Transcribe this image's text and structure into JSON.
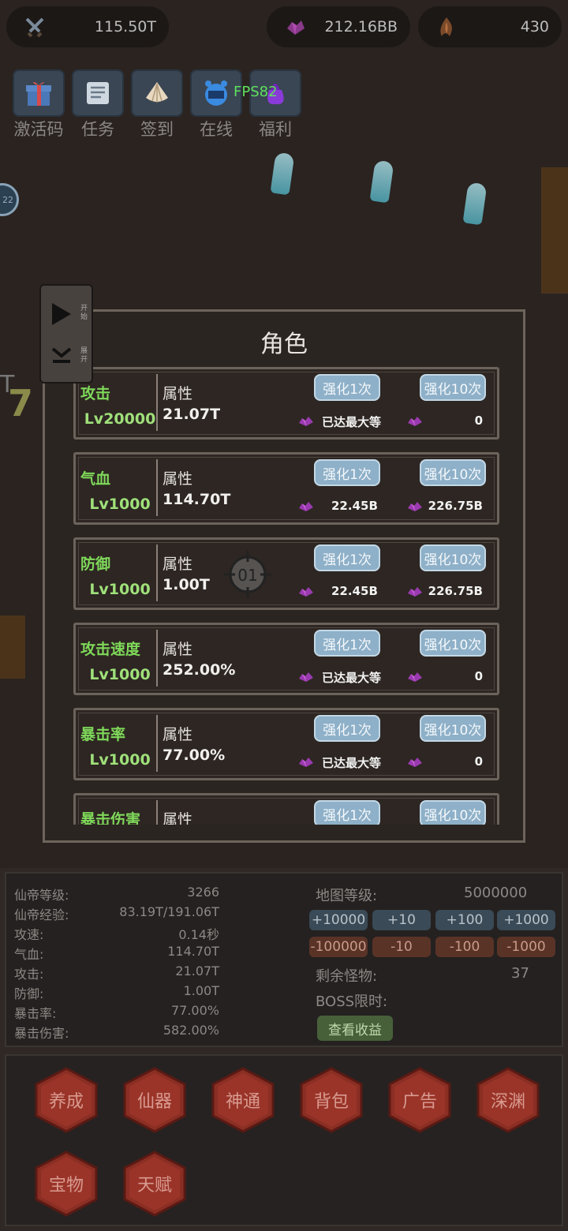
{
  "currency": {
    "attack_power": "115.50T",
    "gems": "212.16BB",
    "souls": "430"
  },
  "fps": "FPS82",
  "top_features": [
    {
      "label": "激活码",
      "icon": "gift-icon"
    },
    {
      "label": "任务",
      "icon": "task-board-icon"
    },
    {
      "label": "签到",
      "icon": "shell-icon"
    },
    {
      "label": "在线",
      "icon": "clock-icon"
    },
    {
      "label": "福利",
      "icon": "magic-bag-icon"
    }
  ],
  "side_circle_badge": "22",
  "side_panel": {
    "start_label": "开始",
    "expand_label": "展开"
  },
  "dialog": {
    "title": "角色",
    "attr_label": "属性",
    "upgrade1_label": "强化1次",
    "upgrade10_label": "强化10次",
    "rows": [
      {
        "name": "攻击",
        "level": "Lv20000",
        "value": "21.07T",
        "cost1": "已达最大等",
        "cost10": "0"
      },
      {
        "name": "气血",
        "level": "Lv1000",
        "value": "114.70T",
        "cost1": "22.45B",
        "cost10": "226.75B"
      },
      {
        "name": "防御",
        "level": "Lv1000",
        "value": "1.00T",
        "cost1": "22.45B",
        "cost10": "226.75B"
      },
      {
        "name": "攻击速度",
        "level": "Lv1000",
        "value": "252.00%",
        "cost1": "已达最大等",
        "cost10": "0"
      },
      {
        "name": "暴击率",
        "level": "Lv1000",
        "value": "77.00%",
        "cost1": "已达最大等",
        "cost10": "0"
      },
      {
        "name": "暴击伤害",
        "level": "",
        "value": "",
        "cost1": "",
        "cost10": ""
      }
    ]
  },
  "crosshair_label": "01",
  "stats": [
    {
      "label": "仙帝等级:",
      "value": "3266"
    },
    {
      "label": "仙帝经验:",
      "value": "83.19T/191.06T"
    },
    {
      "label": "攻速:",
      "value": "0.14秒"
    },
    {
      "label": "气血:",
      "value": "114.70T"
    },
    {
      "label": "攻击:",
      "value": "21.07T"
    },
    {
      "label": "防御:",
      "value": "1.00T"
    },
    {
      "label": "暴击率:",
      "value": "77.00%"
    },
    {
      "label": "暴击伤害:",
      "value": "582.00%"
    }
  ],
  "map": {
    "level_label": "地图等级:",
    "level_value": "5000000",
    "plus_buttons": [
      "+10000",
      "+10",
      "+100",
      "+1000"
    ],
    "minus_buttons": [
      "-100000",
      "-10",
      "-100",
      "-1000"
    ],
    "remaining_label": "剩余怪物:",
    "remaining_value": "37",
    "boss_label": "BOSS限时:",
    "earnings_button": "查看收益"
  },
  "nav": [
    "养成",
    "仙器",
    "神通",
    "背包",
    "广告",
    "深渊",
    "宝物",
    "天赋"
  ]
}
